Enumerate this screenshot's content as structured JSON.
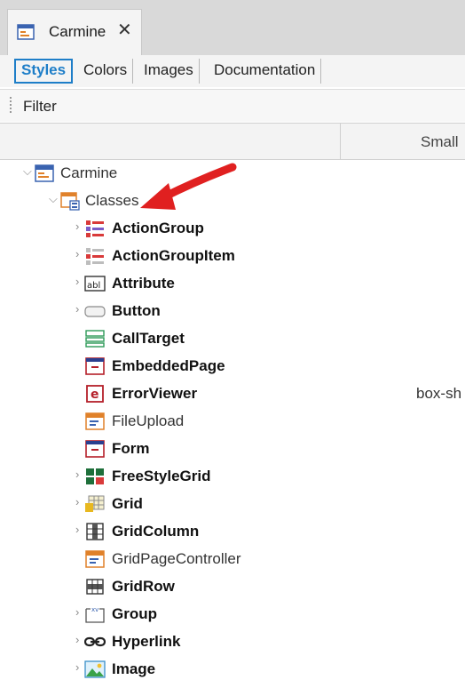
{
  "document_tab": {
    "title": "Carmine",
    "close_glyph": "✕",
    "icon": "theme-icon"
  },
  "sub_tabs": [
    {
      "label": "Styles",
      "active": true
    },
    {
      "label": "Colors",
      "active": false
    },
    {
      "label": "Images",
      "active": false
    },
    {
      "label": "Documentation",
      "active": false
    }
  ],
  "toolbar": {
    "filter_label": "Filter"
  },
  "columns": {
    "small": "Small"
  },
  "tree": {
    "root": {
      "label": "Carmine",
      "icon": "theme-icon"
    },
    "classes": {
      "label": "Classes",
      "icon": "classes-folder-icon"
    },
    "items": [
      {
        "label": "ActionGroup",
        "icon": "action-group-icon",
        "expandable": true,
        "bold": true,
        "value": ""
      },
      {
        "label": "ActionGroupItem",
        "icon": "action-group-item-icon",
        "expandable": true,
        "bold": true,
        "value": ""
      },
      {
        "label": "Attribute",
        "icon": "attribute-icon",
        "expandable": true,
        "bold": true,
        "value": ""
      },
      {
        "label": "Button",
        "icon": "button-icon",
        "expandable": true,
        "bold": true,
        "value": ""
      },
      {
        "label": "CallTarget",
        "icon": "call-target-icon",
        "expandable": false,
        "bold": true,
        "value": ""
      },
      {
        "label": "EmbeddedPage",
        "icon": "embedded-page-icon",
        "expandable": false,
        "bold": true,
        "value": ""
      },
      {
        "label": "ErrorViewer",
        "icon": "error-viewer-icon",
        "expandable": false,
        "bold": true,
        "value": "box-sh"
      },
      {
        "label": "FileUpload",
        "icon": "file-upload-icon",
        "expandable": false,
        "bold": false,
        "value": ""
      },
      {
        "label": "Form",
        "icon": "form-icon",
        "expandable": false,
        "bold": true,
        "value": ""
      },
      {
        "label": "FreeStyleGrid",
        "icon": "freestyle-grid-icon",
        "expandable": true,
        "bold": true,
        "value": ""
      },
      {
        "label": "Grid",
        "icon": "grid-icon",
        "expandable": true,
        "bold": true,
        "value": ""
      },
      {
        "label": "GridColumn",
        "icon": "grid-column-icon",
        "expandable": true,
        "bold": true,
        "value": ""
      },
      {
        "label": "GridPageController",
        "icon": "grid-page-controller-icon",
        "expandable": false,
        "bold": false,
        "value": ""
      },
      {
        "label": "GridRow",
        "icon": "grid-row-icon",
        "expandable": false,
        "bold": true,
        "value": ""
      },
      {
        "label": "Group",
        "icon": "group-icon",
        "expandable": true,
        "bold": true,
        "value": ""
      },
      {
        "label": "Hyperlink",
        "icon": "hyperlink-icon",
        "expandable": true,
        "bold": true,
        "value": ""
      },
      {
        "label": "Image",
        "icon": "image-icon",
        "expandable": true,
        "bold": true,
        "value": ""
      }
    ]
  },
  "colors": {
    "accent": "#1e7ec8",
    "annotation_arrow": "#e02020"
  }
}
